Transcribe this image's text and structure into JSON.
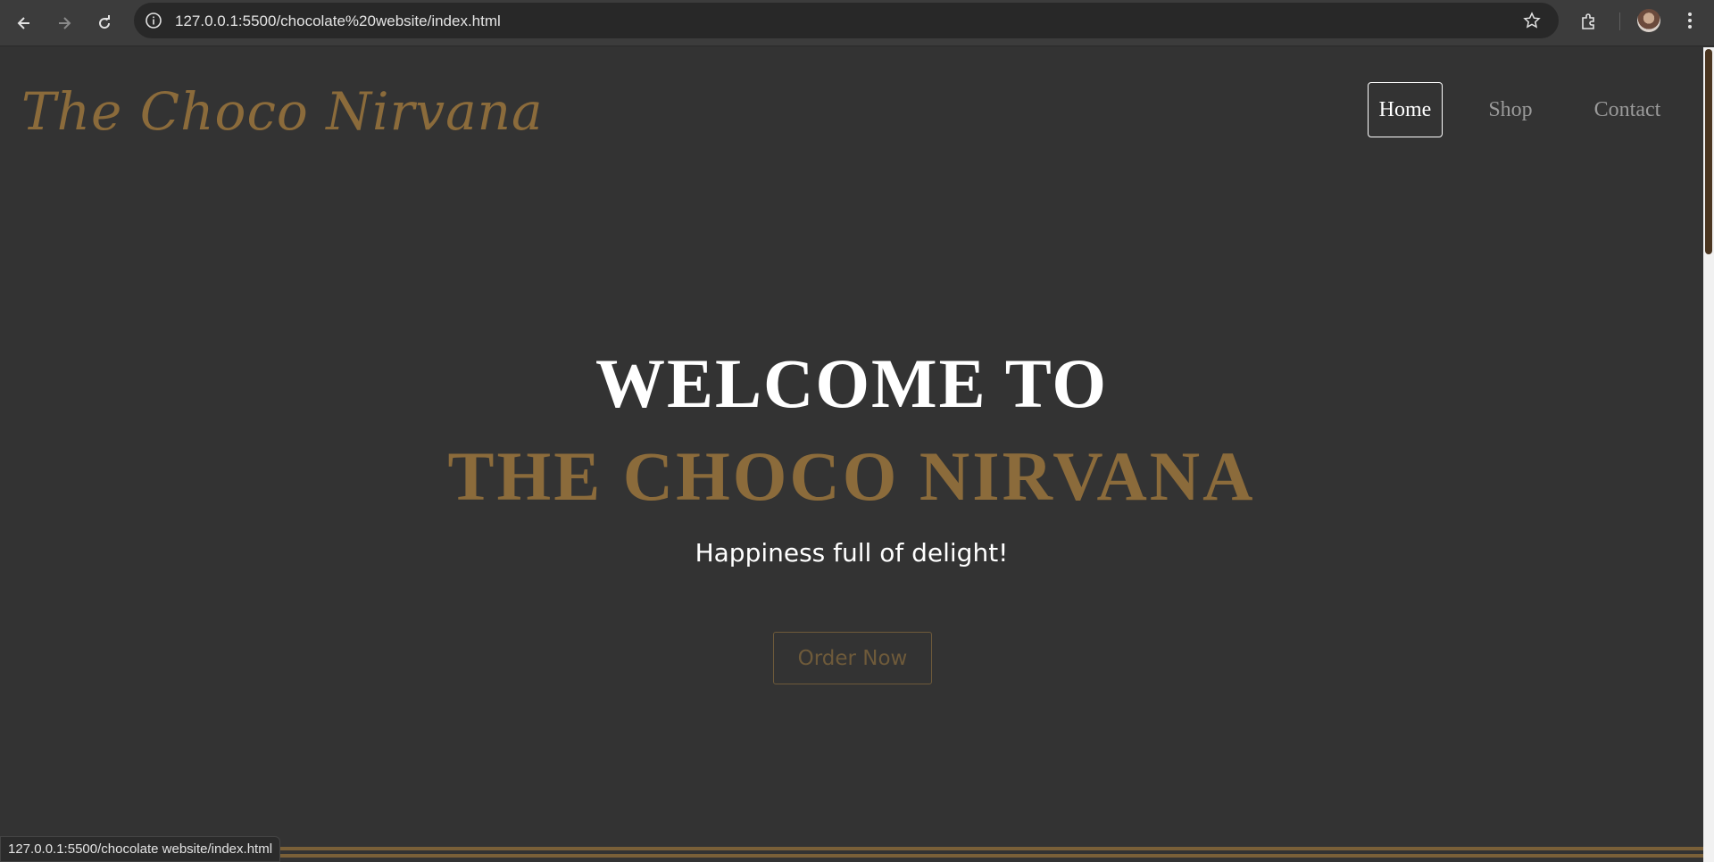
{
  "browser": {
    "url": "127.0.0.1:5500/chocolate%20website/index.html",
    "status_url": "127.0.0.1:5500/chocolate website/index.html",
    "icons": [
      "back-arrow-icon",
      "forward-arrow-icon",
      "reload-icon",
      "site-info-icon",
      "bookmark-star-icon",
      "extensions-icon",
      "profile-avatar",
      "kebab-menu-icon"
    ]
  },
  "site": {
    "logo": "The Choco Nirvana",
    "nav": [
      {
        "label": "Home",
        "active": true
      },
      {
        "label": "Shop",
        "active": false
      },
      {
        "label": "Contact",
        "active": false
      }
    ],
    "hero": {
      "line1": "WELCOME TO",
      "line2": "THE CHOCO NIRVANA",
      "tagline": "Happiness full of delight!",
      "cta": "Order Now"
    }
  },
  "colors": {
    "background": "#333333",
    "accent": "#8b6b3b",
    "text": "#ffffff"
  }
}
